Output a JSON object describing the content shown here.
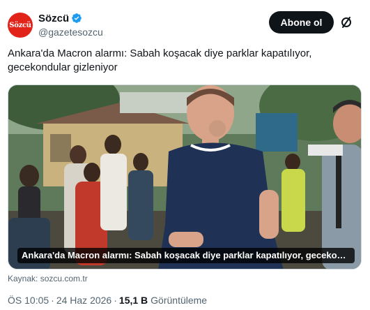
{
  "account": {
    "avatar_text": "Sözcü",
    "name": "Sözcü",
    "handle": "@gazetesozcu",
    "verified": true
  },
  "actions": {
    "follow_label": "Abone ol",
    "grok_icon": "grok-icon"
  },
  "tweet": {
    "text": "Ankara'da Macron alarmı: Sabah koşacak diye parklar kapatılıyor, gecekondular gizleniyor"
  },
  "media": {
    "caption": "Ankara'da Macron alarmı: Sabah koşacak diye parklar kapatılıyor, gecekondular gizleni..."
  },
  "source": "Kaynak: sozcu.com.tr",
  "meta": {
    "time": "ÖS 10:05",
    "separator": "·",
    "date": "24 Haz 2026",
    "views_count": "15,1 B",
    "views_label": "Görüntüleme"
  },
  "colors": {
    "brand_red": "#e2231a",
    "verified_blue": "#1d9bf0",
    "text_primary": "#0f1419",
    "text_secondary": "#536471"
  }
}
